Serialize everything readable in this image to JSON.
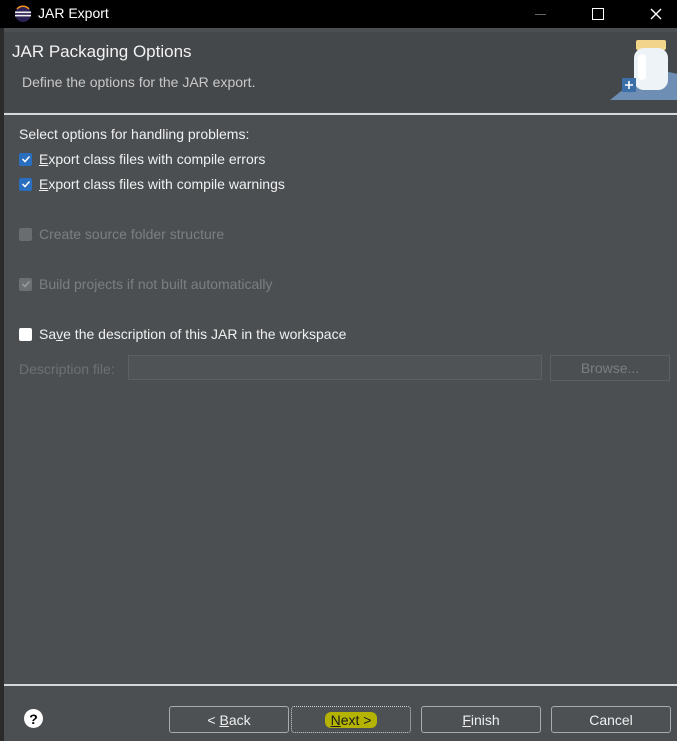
{
  "window": {
    "title": "JAR Export"
  },
  "header": {
    "heading": "JAR Packaging Options",
    "description": "Define the options for the JAR export."
  },
  "options": {
    "section_label": "Select options for handling problems:",
    "export_errors": {
      "prefix": "",
      "mnemonic": "E",
      "rest": "xport class files with compile errors",
      "checked": true,
      "enabled": true
    },
    "export_warnings": {
      "prefix": "",
      "mnemonic": "E",
      "rest": "xport class files with compile warnings",
      "checked": true,
      "enabled": true
    },
    "create_source_folder": {
      "label": "Create source folder structure",
      "checked": false,
      "enabled": false
    },
    "build_projects": {
      "label": "Build projects if not built automatically",
      "checked": true,
      "enabled": false
    },
    "save_description": {
      "prefix": "Sa",
      "mnemonic": "v",
      "rest": "e the description of this JAR in the workspace",
      "checked": false,
      "enabled": true
    }
  },
  "description_file": {
    "label": "Description file:",
    "value": "",
    "browse_label": "Browse..."
  },
  "footer": {
    "help_glyph": "?",
    "back": {
      "prefix": "< ",
      "mnemonic": "B",
      "rest": "ack"
    },
    "next": {
      "mnemonic": "N",
      "rest": "ext >"
    },
    "finish": {
      "mnemonic": "F",
      "rest": "inish"
    },
    "cancel": "Cancel"
  },
  "colors": {
    "background": "#4b4f52",
    "titlebar": "#000000",
    "checkbox_accent": "#2a6fbf",
    "next_highlight": "#b3b300"
  }
}
